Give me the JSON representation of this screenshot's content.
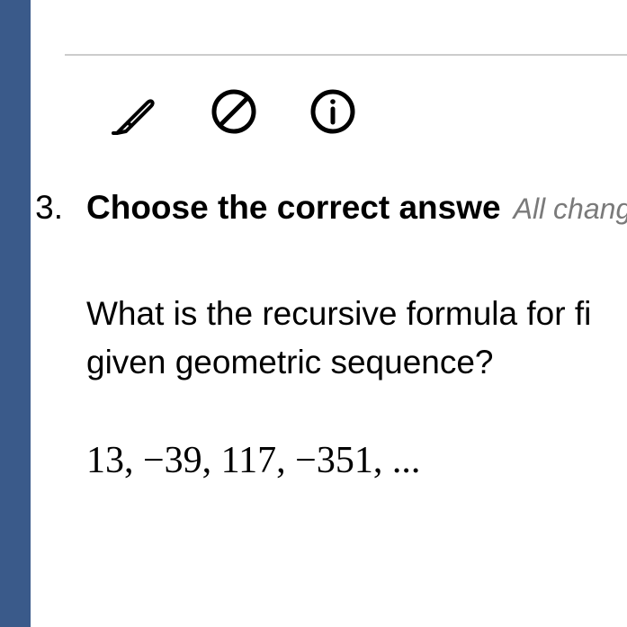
{
  "toolbar": {
    "highlighter_icon": "highlighter-icon",
    "block_icon": "block-icon",
    "info_icon": "info-icon"
  },
  "question": {
    "number_suffix": ".",
    "number_partial": "3",
    "title": "Choose the correct answe",
    "save_status": "All chang",
    "prompt_line1": "What is the recursive formula for fi",
    "prompt_line2": "given geometric sequence?",
    "sequence_display": "13, −39, 117, −351, ..."
  }
}
